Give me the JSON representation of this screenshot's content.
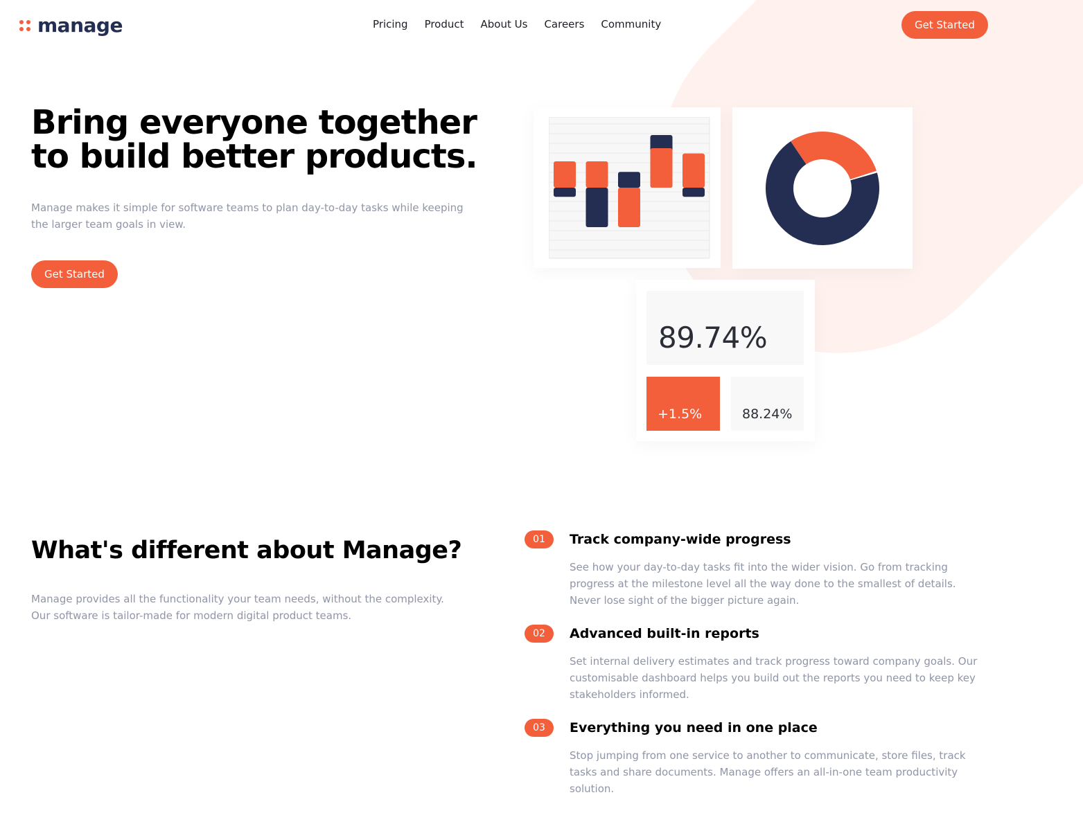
{
  "header": {
    "logo": "manage",
    "nav": [
      "Pricing",
      "Product",
      "About Us",
      "Careers",
      "Community"
    ],
    "cta": "Get Started"
  },
  "hero": {
    "title": "Bring everyone together to build better products.",
    "description": "Manage makes it simple for software teams to plan day-to-day tasks while keeping the larger team goals in view.",
    "cta": "Get Started"
  },
  "dashboard": {
    "bar_chart": {
      "bars": [
        {
          "up_orange": 1.0,
          "down_navy": 0.35
        },
        {
          "up_orange": 1.0,
          "down_navy": 1.5
        },
        {
          "up_navy": 0.6,
          "down_orange": 1.5
        },
        {
          "up_navy": 2.0,
          "up_orange": 1.5
        },
        {
          "up_orange": 1.3,
          "down_navy": 0.35
        }
      ]
    },
    "donut": {
      "orange_fraction": 0.3,
      "navy_fraction": 0.7
    },
    "main_value": "89.74%",
    "change": "+1.5%",
    "secondary_value": "88.24%",
    "colors": {
      "accent": "#f25f3a",
      "navy": "#242d52"
    }
  },
  "features_section": {
    "title": "What's different about Manage?",
    "description": "Manage provides all the functionality your team needs, without the complexity. Our software is tailor-made for modern digital product teams.",
    "items": [
      {
        "number": "01",
        "title": "Track company-wide progress",
        "description": "See how your day-to-day tasks fit into the wider vision. Go from tracking progress at the milestone level all the way done to the smallest of details. Never lose sight of the bigger picture again."
      },
      {
        "number": "02",
        "title": "Advanced built-in reports",
        "description": "Set internal delivery estimates and track progress toward company goals. Our customisable dashboard helps you build out the reports you need to keep key stakeholders informed."
      },
      {
        "number": "03",
        "title": "Everything you need in one place",
        "description": "Stop jumping from one service to another to communicate, store files, track tasks and share documents. Manage offers an all-in-one team productivity solution."
      }
    ]
  }
}
